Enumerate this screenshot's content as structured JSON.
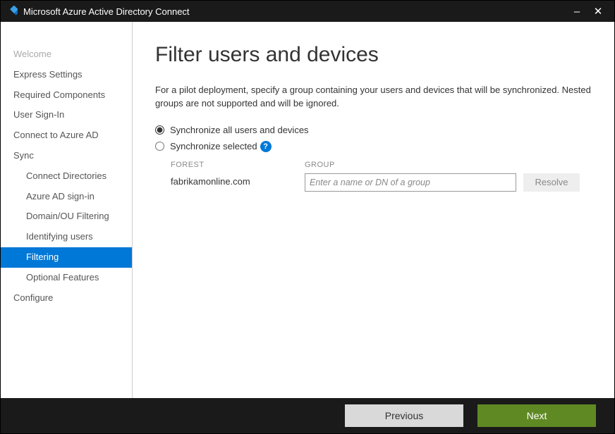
{
  "window": {
    "title": "Microsoft Azure Active Directory Connect"
  },
  "sidebar": {
    "items": [
      {
        "label": "Welcome",
        "state": "disabled",
        "indent": 0
      },
      {
        "label": "Express Settings",
        "state": "normal",
        "indent": 0
      },
      {
        "label": "Required Components",
        "state": "normal",
        "indent": 0
      },
      {
        "label": "User Sign-In",
        "state": "normal",
        "indent": 0
      },
      {
        "label": "Connect to Azure AD",
        "state": "normal",
        "indent": 0
      },
      {
        "label": "Sync",
        "state": "normal",
        "indent": 0
      },
      {
        "label": "Connect Directories",
        "state": "normal",
        "indent": 1
      },
      {
        "label": "Azure AD sign-in",
        "state": "normal",
        "indent": 1
      },
      {
        "label": "Domain/OU Filtering",
        "state": "normal",
        "indent": 1
      },
      {
        "label": "Identifying users",
        "state": "normal",
        "indent": 1
      },
      {
        "label": "Filtering",
        "state": "active",
        "indent": 1
      },
      {
        "label": "Optional Features",
        "state": "normal",
        "indent": 1
      },
      {
        "label": "Configure",
        "state": "normal",
        "indent": 0
      }
    ]
  },
  "main": {
    "title": "Filter users and devices",
    "description": "For a pilot deployment, specify a group containing your users and devices that will be synchronized. Nested groups are not supported and will be ignored.",
    "radios": {
      "sync_all": "Synchronize all users and devices",
      "sync_selected": "Synchronize selected"
    },
    "columns": {
      "forest": "FOREST",
      "group": "GROUP"
    },
    "row": {
      "forest_value": "fabrikamonline.com",
      "group_placeholder": "Enter a name or DN of a group",
      "resolve_label": "Resolve"
    }
  },
  "footer": {
    "previous": "Previous",
    "next": "Next"
  }
}
